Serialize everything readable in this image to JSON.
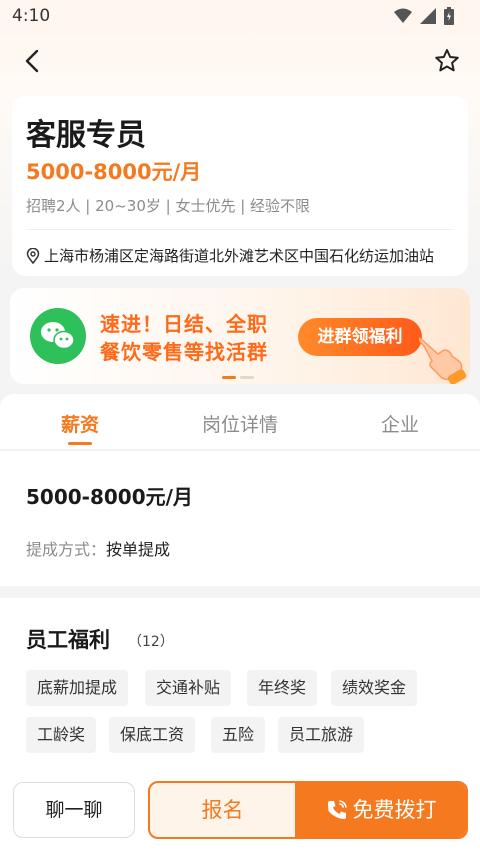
{
  "status_bar": {
    "time": "4:10"
  },
  "job": {
    "title": "客服专员",
    "salary": "5000-8000元/月",
    "tags": "招聘2人 | 20~30岁 | 女士优先 | 经验不限",
    "address": "上海市杨浦区定海路街道北外滩艺术区中国石化纺运加油站"
  },
  "banner": {
    "line1": "速进！日结、全职",
    "line2": "餐饮零售等找活群",
    "button": "进群领福利"
  },
  "tabs": [
    {
      "label": "薪资"
    },
    {
      "label": "岗位详情"
    },
    {
      "label": "企业"
    }
  ],
  "salary_section": {
    "amount": "5000-8000元/月",
    "commission_label": "提成方式：",
    "commission_value": "按单提成"
  },
  "benefits": {
    "title": "员工福利",
    "count": "（12）",
    "items": [
      "底薪加提成",
      "交通补贴",
      "年终奖",
      "绩效奖金",
      "工龄奖",
      "保底工资",
      "五险",
      "员工旅游"
    ]
  },
  "bottom": {
    "chat": "聊一聊",
    "apply": "报名",
    "call": "免费拨打"
  },
  "colors": {
    "accent": "#f5791f",
    "wechat": "#2ec05a"
  }
}
